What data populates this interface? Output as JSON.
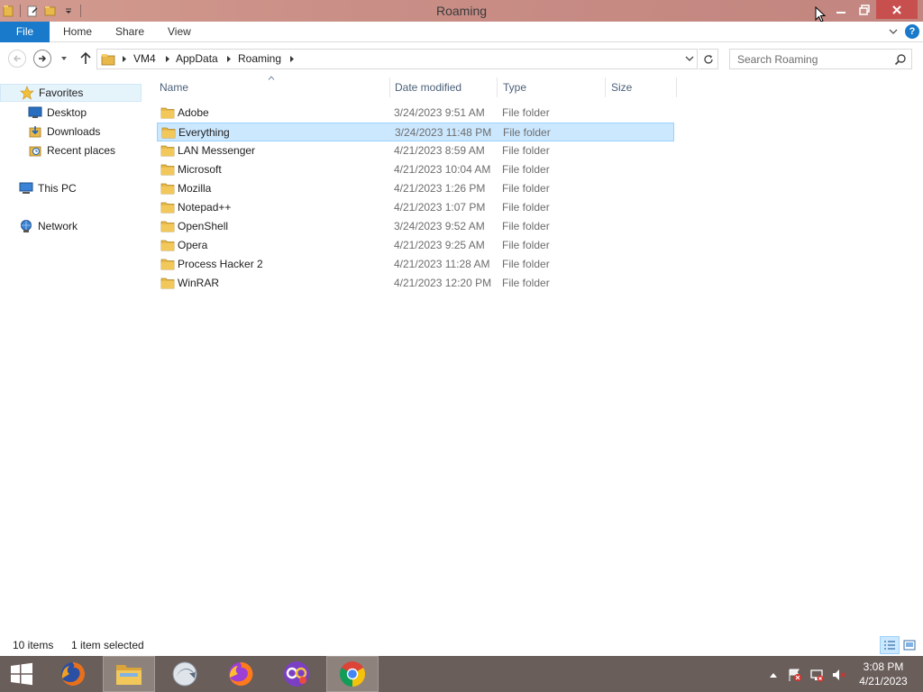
{
  "window": {
    "title": "Roaming",
    "minimize_label": "Minimize",
    "maximize_label": "Maximize",
    "close_label": "Close"
  },
  "ribbon": {
    "tabs": [
      {
        "label": "File"
      },
      {
        "label": "Home"
      },
      {
        "label": "Share"
      },
      {
        "label": "View"
      }
    ],
    "help_label": "?"
  },
  "address": {
    "crumbs": [
      "VM4",
      "AppData",
      "Roaming"
    ]
  },
  "search": {
    "placeholder": "Search Roaming"
  },
  "navpane": {
    "favorites": {
      "label": "Favorites",
      "items": [
        {
          "label": "Desktop",
          "icon": "desktop-icon"
        },
        {
          "label": "Downloads",
          "icon": "downloads-icon"
        },
        {
          "label": "Recent places",
          "icon": "recent-places-icon"
        }
      ]
    },
    "this_pc": {
      "label": "This PC"
    },
    "network": {
      "label": "Network"
    }
  },
  "columns": {
    "name": "Name",
    "date": "Date modified",
    "type": "Type",
    "size": "Size"
  },
  "rows": [
    {
      "name": "Adobe",
      "date": "3/24/2023 9:51 AM",
      "type": "File folder",
      "size": "",
      "selected": false
    },
    {
      "name": "Everything",
      "date": "3/24/2023 11:48 PM",
      "type": "File folder",
      "size": "",
      "selected": true
    },
    {
      "name": "LAN Messenger",
      "date": "4/21/2023 8:59 AM",
      "type": "File folder",
      "size": "",
      "selected": false
    },
    {
      "name": "Microsoft",
      "date": "4/21/2023 10:04 AM",
      "type": "File folder",
      "size": "",
      "selected": false
    },
    {
      "name": "Mozilla",
      "date": "4/21/2023 1:26 PM",
      "type": "File folder",
      "size": "",
      "selected": false
    },
    {
      "name": "Notepad++",
      "date": "4/21/2023 1:07 PM",
      "type": "File folder",
      "size": "",
      "selected": false
    },
    {
      "name": "OpenShell",
      "date": "3/24/2023 9:52 AM",
      "type": "File folder",
      "size": "",
      "selected": false
    },
    {
      "name": "Opera",
      "date": "4/21/2023 9:25 AM",
      "type": "File folder",
      "size": "",
      "selected": false
    },
    {
      "name": "Process Hacker 2",
      "date": "4/21/2023 11:28 AM",
      "type": "File folder",
      "size": "",
      "selected": false
    },
    {
      "name": "WinRAR",
      "date": "4/21/2023 12:20 PM",
      "type": "File folder",
      "size": "",
      "selected": false
    }
  ],
  "status": {
    "items": "10 items",
    "selection": "1 item selected"
  },
  "taskbar": {
    "apps": [
      {
        "name": "firefox-icon",
        "active": false
      },
      {
        "name": "file-explorer-icon",
        "active": true
      },
      {
        "name": "app-arrow-icon",
        "active": false
      },
      {
        "name": "firefox-alt-icon",
        "active": false
      },
      {
        "name": "purple-app-icon",
        "active": false
      },
      {
        "name": "chrome-icon",
        "active": true
      }
    ],
    "time": "3:08 PM",
    "date": "4/21/2023"
  },
  "colors": {
    "title_bar": "#c98e86",
    "file_tab": "#1979ca",
    "selection": "#cce8ff",
    "selection_border": "#99d1ff",
    "folder": "#e8b84a",
    "taskbar": "#6a5e5a"
  }
}
